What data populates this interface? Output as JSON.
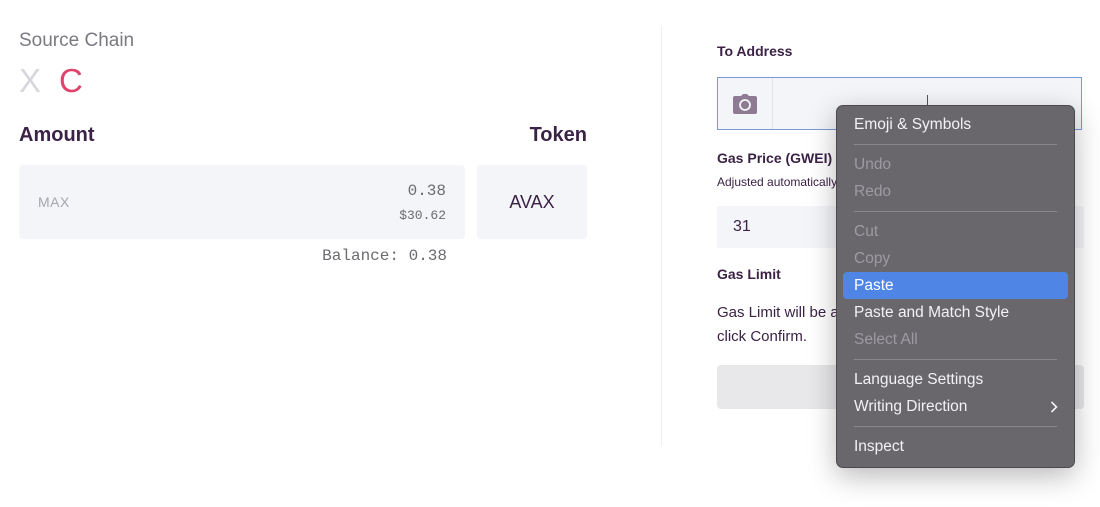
{
  "source_chain": {
    "label": "Source Chain",
    "options": [
      {
        "label": "X",
        "selected": false
      },
      {
        "label": "C",
        "selected": true
      }
    ],
    "selected_color": "#e0436b",
    "unselected_color": "#d8d8dc"
  },
  "amount": {
    "label": "Amount",
    "max_label": "MAX",
    "value": "0.38",
    "usd_value": "$30.62",
    "balance_text": "Balance: 0.38"
  },
  "token": {
    "label": "Token",
    "selected": "AVAX"
  },
  "to_address": {
    "label": "To Address",
    "value": "",
    "camera_icon": "camera-icon"
  },
  "gas_price": {
    "label": "Gas Price (GWEI)",
    "hint": "Adjusted automatically",
    "value": "31"
  },
  "gas_limit": {
    "label": "Gas Limit",
    "description": "Gas Limit will be automatically calculated after you click Confirm."
  },
  "confirm_button": {
    "label": "",
    "disabled": true
  },
  "context_menu": {
    "groups": [
      [
        {
          "label": "Emoji & Symbols",
          "disabled": false
        }
      ],
      [
        {
          "label": "Undo",
          "disabled": true
        },
        {
          "label": "Redo",
          "disabled": true
        }
      ],
      [
        {
          "label": "Cut",
          "disabled": true
        },
        {
          "label": "Copy",
          "disabled": true
        },
        {
          "label": "Paste",
          "disabled": false,
          "highlighted": true
        },
        {
          "label": "Paste and Match Style",
          "disabled": false
        },
        {
          "label": "Select All",
          "disabled": true
        }
      ],
      [
        {
          "label": "Language Settings",
          "disabled": false
        },
        {
          "label": "Writing Direction",
          "disabled": false,
          "submenu": true
        }
      ],
      [
        {
          "label": "Inspect",
          "disabled": false
        }
      ]
    ],
    "highlight_color": "#4f86e6",
    "submenu_icon": "chevron-right-icon"
  }
}
